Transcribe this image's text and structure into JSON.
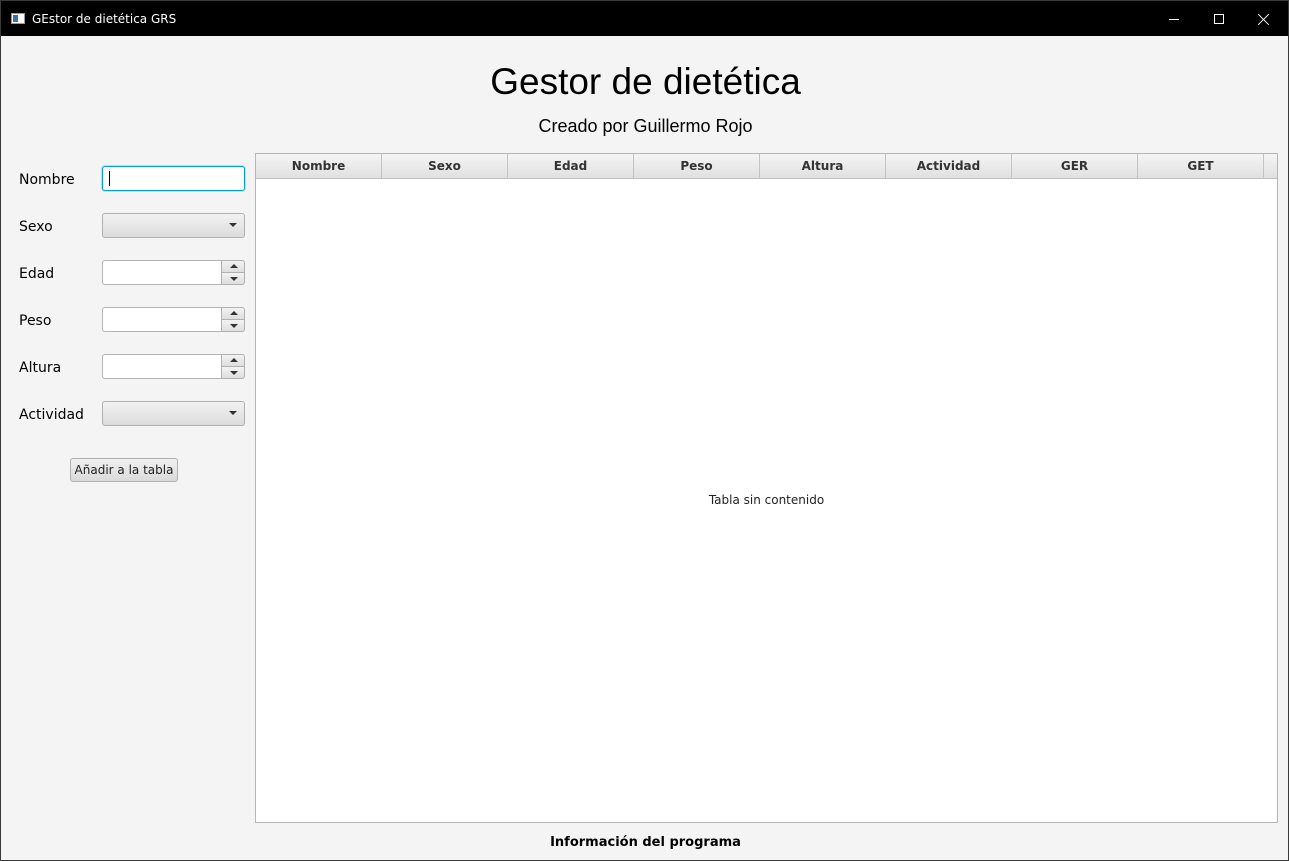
{
  "window": {
    "title": "GEstor de dietética GRS"
  },
  "header": {
    "title": "Gestor de dietética",
    "subtitle": "Creado por Guillermo Rojo"
  },
  "form": {
    "nombre": {
      "label": "Nombre",
      "value": ""
    },
    "sexo": {
      "label": "Sexo",
      "selected": ""
    },
    "edad": {
      "label": "Edad",
      "value": ""
    },
    "peso": {
      "label": "Peso",
      "value": ""
    },
    "altura": {
      "label": "Altura",
      "value": ""
    },
    "actividad": {
      "label": "Actividad",
      "selected": ""
    },
    "add_button_label": "Añadir a la tabla"
  },
  "table": {
    "columns": [
      "Nombre",
      "Sexo",
      "Edad",
      "Peso",
      "Altura",
      "Actividad",
      "GER",
      "GET"
    ],
    "rows": [],
    "placeholder": "Tabla sin contenido"
  },
  "footer": {
    "label": "Información del programa"
  },
  "colors": {
    "focus_accent": "#039ed3",
    "window_background": "#f4f4f4",
    "titlebar_background": "#000000"
  },
  "icons": {
    "app": "app-window-icon",
    "minimize": "minimize-icon",
    "maximize": "maximize-icon",
    "close": "close-icon",
    "dropdown": "chevron-down-icon",
    "spin_up": "chevron-up-icon",
    "spin_down": "chevron-down-icon"
  }
}
